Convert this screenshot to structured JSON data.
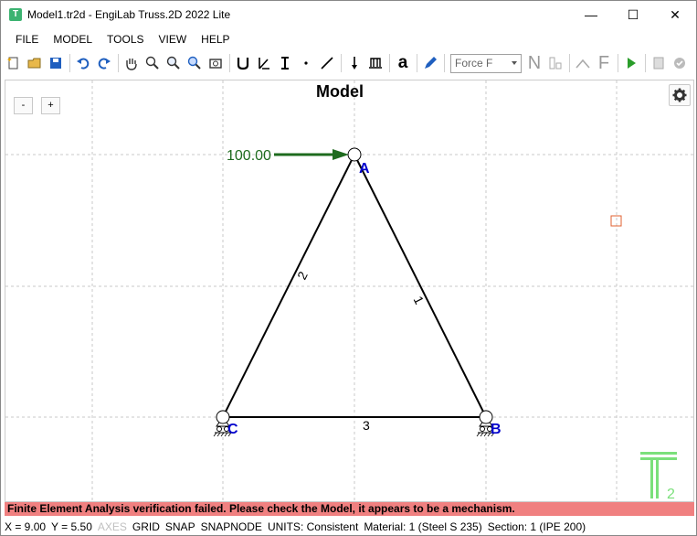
{
  "window": {
    "title": "Model1.tr2d - EngiLab Truss.2D 2022 Lite",
    "min_label": "—",
    "max_label": "☐",
    "close_label": "✕"
  },
  "menu": [
    "FILE",
    "MODEL",
    "TOOLS",
    "VIEW",
    "HELP"
  ],
  "toolbar": {
    "load_select_value": "Force F",
    "n_label": "N",
    "f_label": "F",
    "text_label": "a"
  },
  "canvas": {
    "title": "Model",
    "zoom_out_label": "-",
    "zoom_in_label": "+",
    "load_value": "100.00",
    "nodes": [
      "A",
      "B",
      "C"
    ],
    "elements": [
      "1",
      "2",
      "3"
    ],
    "logo_subscript": "2"
  },
  "error_message": "Finite Element Analysis verification failed. Please check the Model, it appears to be a mechanism.",
  "status": {
    "x": "X = 9.00",
    "y": "Y = 5.50",
    "axes": "AXES",
    "grid": "GRID",
    "snap": "SNAP",
    "snapnode": "SNAPNODE",
    "units": "UNITS: Consistent",
    "material": "Material: 1 (Steel S 235)",
    "section": "Section: 1 (IPE 200)"
  },
  "colors": {
    "load": "#1e6b1e",
    "node_label": "#0000cc",
    "error_bg": "#f08080",
    "logo": "#7be07b"
  }
}
